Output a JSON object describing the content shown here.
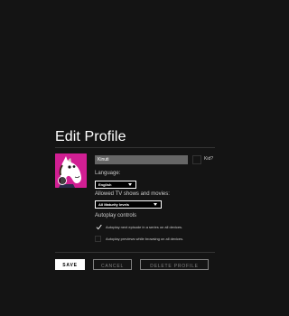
{
  "page": {
    "title": "Edit Profile"
  },
  "profile": {
    "name_value": "Kinuti",
    "kid_label": "Kid?",
    "avatar_icon": "horse-character-avatar",
    "edit_icon": "pencil-icon"
  },
  "language": {
    "label": "Language:",
    "selected": "English"
  },
  "maturity": {
    "label": "Allowed TV shows and movies:",
    "selected": "All Maturity levels"
  },
  "autoplay": {
    "label": "Autoplay controls",
    "next_episode": {
      "text": "Autoplay next episode in a series on all devices.",
      "checked": true
    },
    "previews": {
      "text": "Autoplay previews while browsing on all devices.",
      "checked": false
    }
  },
  "buttons": {
    "save": "SAVE",
    "cancel": "CANCEL",
    "delete": "DELETE PROFILE"
  },
  "colors": {
    "background": "#141414",
    "avatar_bg": "#d11f93",
    "input_bg": "#666666",
    "divider": "#333333",
    "muted": "#808080"
  }
}
